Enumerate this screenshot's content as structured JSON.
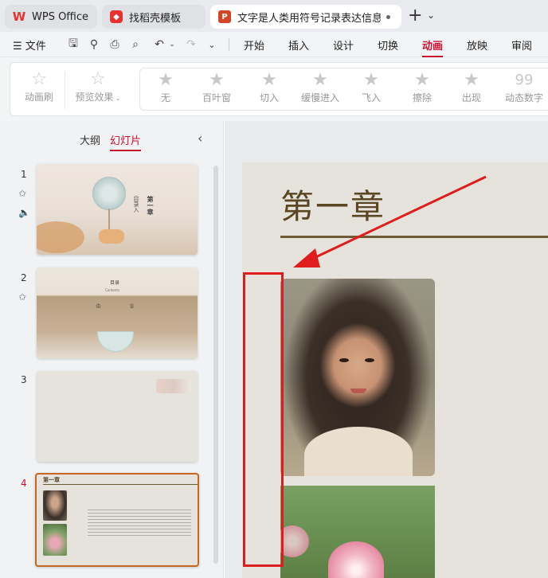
{
  "tabs": [
    {
      "label": "WPS Office",
      "icon": "wps-logo-icon"
    },
    {
      "label": "找稻壳模板",
      "icon": "docer-icon"
    },
    {
      "label": "文字是人类用符号记录表达信息以",
      "icon": "ppt-file-icon"
    }
  ],
  "menubar": {
    "file_label": "文件",
    "tabs": [
      "开始",
      "插入",
      "设计",
      "切换",
      "动画",
      "放映",
      "审阅"
    ],
    "active_tab": "动画"
  },
  "ribbon": {
    "animation_brush": "动画刷",
    "preview": "预览效果",
    "effects": [
      "无",
      "百叶窗",
      "切入",
      "缓慢进入",
      "飞入",
      "擦除",
      "出现",
      "动态数字"
    ]
  },
  "panel": {
    "outline_tab": "大纲",
    "slides_tab": "幻灯片",
    "slide_numbers": [
      "1",
      "2",
      "3",
      "4"
    ]
  },
  "thumbs": {
    "s1_small": "目录入",
    "s1_big": "第一章",
    "s2_title": "目录",
    "s2_sub": "Contents",
    "s4_title": "第一章"
  },
  "slide": {
    "title": "第一章"
  },
  "colors": {
    "accent": "#c8102e",
    "annotation": "#e01d1d",
    "title_brown": "#5b4624"
  }
}
